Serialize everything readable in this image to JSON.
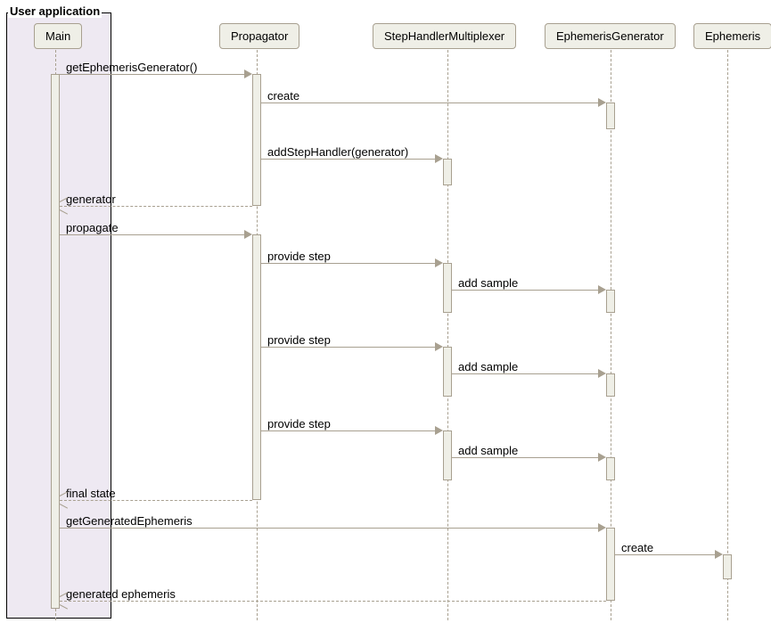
{
  "frame": {
    "title": "User application"
  },
  "participants": {
    "main": "Main",
    "propagator": "Propagator",
    "multiplexer": "StepHandlerMultiplexer",
    "generator": "EphemerisGenerator",
    "ephemeris": "Ephemeris"
  },
  "messages": {
    "getEphemerisGenerator": "getEphemerisGenerator()",
    "create1": "create",
    "addStepHandler": "addStepHandler(generator)",
    "returnGenerator": "generator",
    "propagate": "propagate",
    "provideStep1": "provide step",
    "addSample1": "add sample",
    "provideStep2": "provide step",
    "addSample2": "add sample",
    "provideStep3": "provide step",
    "addSample3": "add sample",
    "finalState": "final state",
    "getGeneratedEphemeris": "getGeneratedEphemeris",
    "create2": "create",
    "generatedEphemeris": "generated ephemeris"
  },
  "chart_data": {
    "type": "sequence-diagram",
    "frame": "User application",
    "participants": [
      "Main",
      "Propagator",
      "StepHandlerMultiplexer",
      "EphemerisGenerator",
      "Ephemeris"
    ],
    "messages": [
      {
        "from": "Main",
        "to": "Propagator",
        "label": "getEphemerisGenerator()",
        "kind": "call"
      },
      {
        "from": "Propagator",
        "to": "EphemerisGenerator",
        "label": "create",
        "kind": "call"
      },
      {
        "from": "Propagator",
        "to": "StepHandlerMultiplexer",
        "label": "addStepHandler(generator)",
        "kind": "call"
      },
      {
        "from": "Propagator",
        "to": "Main",
        "label": "generator",
        "kind": "return"
      },
      {
        "from": "Main",
        "to": "Propagator",
        "label": "propagate",
        "kind": "call"
      },
      {
        "from": "Propagator",
        "to": "StepHandlerMultiplexer",
        "label": "provide step",
        "kind": "call"
      },
      {
        "from": "StepHandlerMultiplexer",
        "to": "EphemerisGenerator",
        "label": "add sample",
        "kind": "call"
      },
      {
        "from": "Propagator",
        "to": "StepHandlerMultiplexer",
        "label": "provide step",
        "kind": "call"
      },
      {
        "from": "StepHandlerMultiplexer",
        "to": "EphemerisGenerator",
        "label": "add sample",
        "kind": "call"
      },
      {
        "from": "Propagator",
        "to": "StepHandlerMultiplexer",
        "label": "provide step",
        "kind": "call"
      },
      {
        "from": "StepHandlerMultiplexer",
        "to": "EphemerisGenerator",
        "label": "add sample",
        "kind": "call"
      },
      {
        "from": "Propagator",
        "to": "Main",
        "label": "final state",
        "kind": "return"
      },
      {
        "from": "Main",
        "to": "EphemerisGenerator",
        "label": "getGeneratedEphemeris",
        "kind": "call"
      },
      {
        "from": "EphemerisGenerator",
        "to": "Ephemeris",
        "label": "create",
        "kind": "call"
      },
      {
        "from": "EphemerisGenerator",
        "to": "Main",
        "label": "generated ephemeris",
        "kind": "return"
      }
    ]
  }
}
